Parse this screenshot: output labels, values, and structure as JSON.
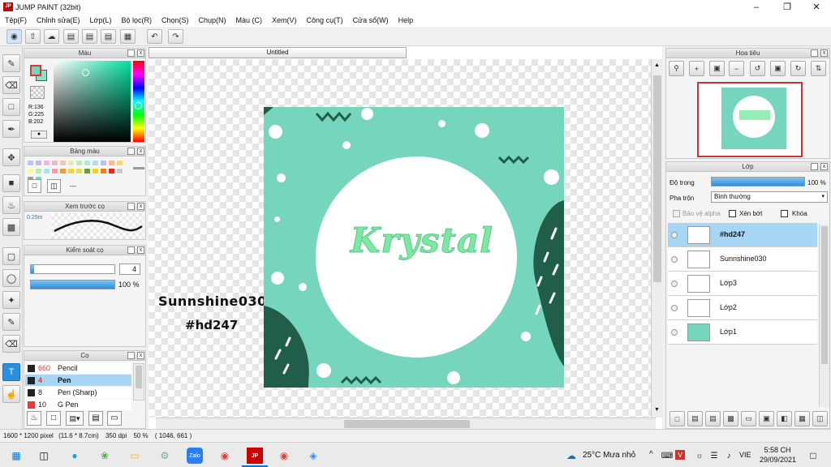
{
  "window": {
    "title": "JUMP PAINT (32bit)",
    "app_icon": "JP",
    "minimize": "–",
    "maximize": "❐",
    "close": "✕"
  },
  "menu": [
    "Tệp(F)",
    "Chỉnh sửa(E)",
    "Lớp(L)",
    "Bộ lọc(R)",
    "Chọn(S)",
    "Chụp(N)",
    "Màu (C)",
    "Xem(V)",
    "Công cụ(T)",
    "Cửa sổ(W)",
    "Help"
  ],
  "color_panel": {
    "title": "Màu",
    "r": "R:136",
    "g": "G:225",
    "b": "B:202",
    "fg": "#88e1ca",
    "bg": "#d23a3a"
  },
  "palette_panel": {
    "title": "Bảng màu",
    "menu_label": "---",
    "colors": [
      "#b9c9ea",
      "#c6b9ea",
      "#e9b9e2",
      "#eab9c4",
      "#eac9b9",
      "#e7e8b7",
      "#c3e8b6",
      "#b4e7d5",
      "#b7dde9",
      "#b8c1ea",
      "#f8b88e",
      "#f6d678",
      "#fff7a5",
      "#b9ecae",
      "#a4e6ee",
      "#f6a0a2",
      "#ef9c42",
      "#f5d145",
      "#e1df57",
      "#6a9d3c",
      "#efd12b",
      "#f07a2a",
      "#e12826",
      "#c9c9c9",
      "#9d9d9d",
      "#77d7c0",
      "#fbfbfb"
    ]
  },
  "brush_preview": {
    "title": "Xem trước cọ",
    "size": "0.29m"
  },
  "brush_control": {
    "title": "Kiểm soát cọ",
    "size": "4",
    "opacity": "100 %",
    "size_fill": 0.04,
    "opacity_fill": 1.0
  },
  "brush_panel": {
    "title": "Cọ",
    "rows": [
      {
        "size": "660",
        "name": "Pencil",
        "color": "#222222",
        "selected": false,
        "size_color": "#d93b3b"
      },
      {
        "size": "4",
        "name": "Pen",
        "color": "#222222",
        "selected": true,
        "size_color": "#d93b3b"
      },
      {
        "size": "8",
        "name": "Pen (Sharp)",
        "color": "#222222",
        "selected": false,
        "size_color": "#222222"
      },
      {
        "size": "10",
        "name": "G Pen",
        "color": "#e23b3b",
        "selected": false,
        "size_color": "#222222"
      }
    ]
  },
  "document": {
    "tab": "Untitled"
  },
  "artwork": {
    "title": "Krystal",
    "credit1": "Sunnshine030",
    "credit2": "#hd247",
    "bg": "#75d5bd",
    "dark": "#215e4a",
    "text": "#7be8a3"
  },
  "navigator": {
    "title": "Hoa tiêu"
  },
  "layers": {
    "title": "Lớp",
    "opacity_label": "Độ trong",
    "opacity": "100 %",
    "opacity_fill": 1.0,
    "blend_label": "Pha trộn",
    "blend": "Bình thường",
    "alpha_lock": "Bảo vệ alpha",
    "clip": "Xén bớt",
    "lock": "Khóa",
    "items": [
      {
        "name": "#hd247",
        "selected": true
      },
      {
        "name": "Sunnshine030",
        "selected": false
      },
      {
        "name": "Lớp3",
        "selected": false
      },
      {
        "name": "Lớp2",
        "selected": false
      },
      {
        "name": "Lớp1",
        "selected": false
      }
    ]
  },
  "status": {
    "size": "1600 * 1200 pixel",
    "dims": "(11.6 * 8.7cm)",
    "dpi": "350 dpi",
    "zoom": "50 %",
    "coords": "( 1046, 661 )"
  },
  "taskbar": {
    "weather": "25°C  Mưa nhỏ",
    "lang": "VIE",
    "time": "5:58 CH",
    "date": "29/09/2021",
    "caret": "^"
  }
}
